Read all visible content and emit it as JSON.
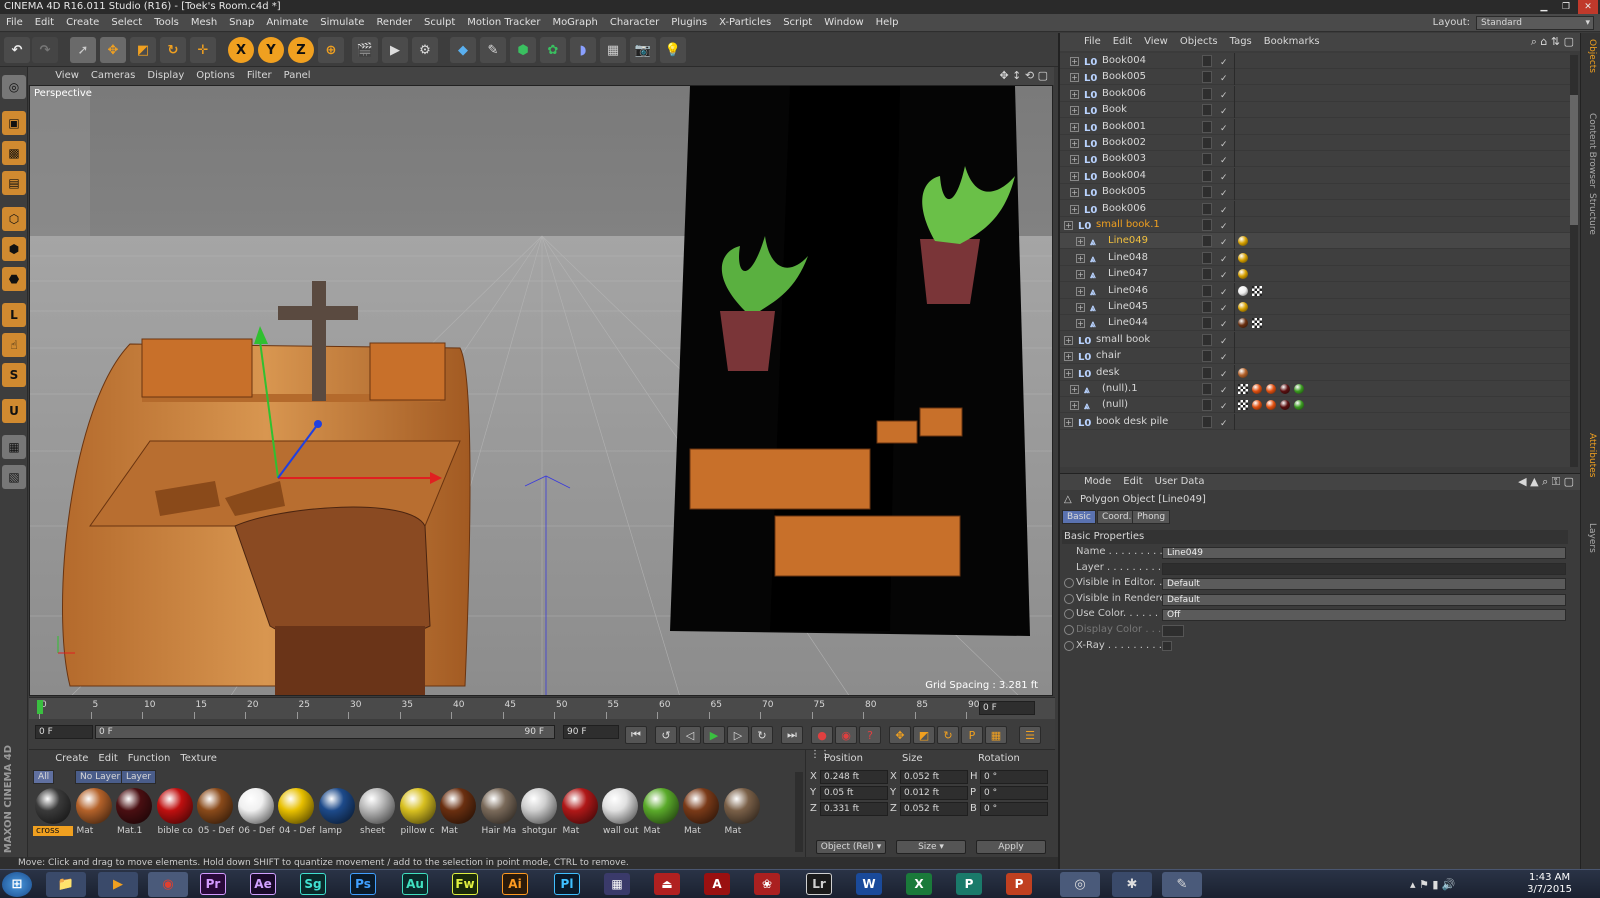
{
  "window": {
    "title": "CINEMA 4D R16.011 Studio (R16) - [Toek's Room.c4d *]"
  },
  "menubar": {
    "items": [
      "File",
      "Edit",
      "Create",
      "Select",
      "Tools",
      "Mesh",
      "Snap",
      "Animate",
      "Simulate",
      "Render",
      "Sculpt",
      "Motion Tracker",
      "MoGraph",
      "Character",
      "Plugins",
      "X-Particles",
      "Script",
      "Window",
      "Help"
    ],
    "layout_label": "Layout:",
    "layout_value": "Standard"
  },
  "toolbar": {
    "axis_x": "X",
    "axis_y": "Y",
    "axis_z": "Z"
  },
  "viewport": {
    "menu": [
      "View",
      "Cameras",
      "Display",
      "Options",
      "Filter",
      "Panel"
    ],
    "label": "Perspective",
    "grid_spacing": "Grid Spacing : 3.281 ft"
  },
  "timeline": {
    "ticks": [
      "0",
      "5",
      "10",
      "15",
      "20",
      "25",
      "30",
      "35",
      "40",
      "45",
      "50",
      "55",
      "60",
      "65",
      "70",
      "75",
      "80",
      "85",
      "90"
    ],
    "current": "0 F",
    "start": "0 F",
    "range_start": "0 F",
    "range_end": "90 F",
    "end": "90 F"
  },
  "material_manager": {
    "menu": [
      "Create",
      "Edit",
      "Function",
      "Texture"
    ],
    "tabs": [
      "All",
      "No Layer",
      "Layer"
    ],
    "materials": [
      {
        "name": "cross",
        "color": "#3a3a3a"
      },
      {
        "name": "Mat",
        "color": "#b4622a"
      },
      {
        "name": "Mat.1",
        "color": "#4a0f12"
      },
      {
        "name": "bible co",
        "color": "#c01010"
      },
      {
        "name": "05 - Def",
        "color": "#8a4a1a"
      },
      {
        "name": "06 - Def",
        "color": "#f0f0f0"
      },
      {
        "name": "04 - Def",
        "color": "#e8c000"
      },
      {
        "name": "lamp",
        "color": "#1d4a8a"
      },
      {
        "name": "sheet",
        "color": "#b8b8b8"
      },
      {
        "name": "pillow c",
        "color": "#d8c020"
      },
      {
        "name": "Mat",
        "color": "#6a2f10"
      },
      {
        "name": "Hair Ma",
        "color": "#7a6a5a"
      },
      {
        "name": "shotgur",
        "color": "#cfcfcf"
      },
      {
        "name": "Mat",
        "color": "#b01818"
      },
      {
        "name": "wall out",
        "color": "#e0e0e0"
      },
      {
        "name": "Mat",
        "color": "#5aaa2a"
      },
      {
        "name": "Mat",
        "color": "#7a3a18"
      },
      {
        "name": "Mat",
        "color": "#7a6048"
      }
    ]
  },
  "coordinates": {
    "headers": [
      "Position",
      "Size",
      "Rotation"
    ],
    "rows": [
      {
        "axis": "X",
        "pos": "0.248 ft",
        "size_axis": "X",
        "size": "0.052 ft",
        "rot_axis": "H",
        "rot": "0 °"
      },
      {
        "axis": "Y",
        "pos": "0.05 ft",
        "size_axis": "Y",
        "size": "0.012 ft",
        "rot_axis": "P",
        "rot": "0 °"
      },
      {
        "axis": "Z",
        "pos": "0.331 ft",
        "size_axis": "Z",
        "size": "0.052 ft",
        "rot_axis": "B",
        "rot": "0 °"
      }
    ],
    "mode": "Object (Rel)",
    "size_mode": "Size",
    "apply": "Apply"
  },
  "status": "Move: Click and drag to move elements. Hold down SHIFT to quantize movement / add to the selection in point mode, CTRL to remove.",
  "object_manager": {
    "menu": [
      "File",
      "Edit",
      "View",
      "Objects",
      "Tags",
      "Bookmarks"
    ],
    "objects": [
      {
        "name": "Book004",
        "indent": 1,
        "highlight": false,
        "tags": []
      },
      {
        "name": "Book005",
        "indent": 1,
        "highlight": false,
        "tags": []
      },
      {
        "name": "Book006",
        "indent": 1,
        "highlight": false,
        "tags": []
      },
      {
        "name": "Book",
        "indent": 1,
        "highlight": false,
        "tags": []
      },
      {
        "name": "Book001",
        "indent": 1,
        "highlight": false,
        "tags": []
      },
      {
        "name": "Book002",
        "indent": 1,
        "highlight": false,
        "tags": []
      },
      {
        "name": "Book003",
        "indent": 1,
        "highlight": false,
        "tags": []
      },
      {
        "name": "Book004",
        "indent": 1,
        "highlight": false,
        "tags": []
      },
      {
        "name": "Book005",
        "indent": 1,
        "highlight": false,
        "tags": []
      },
      {
        "name": "Book006",
        "indent": 1,
        "highlight": false,
        "tags": []
      },
      {
        "name": "small book.1",
        "indent": 0,
        "highlight": "orange",
        "tags": []
      },
      {
        "name": "Line049",
        "indent": 2,
        "highlight": "selected",
        "tags": [
          "#d6a000"
        ]
      },
      {
        "name": "Line048",
        "indent": 2,
        "highlight": false,
        "tags": [
          "#d6a000"
        ]
      },
      {
        "name": "Line047",
        "indent": 2,
        "highlight": false,
        "tags": [
          "#d6a000"
        ]
      },
      {
        "name": "Line046",
        "indent": 2,
        "highlight": false,
        "tags": [
          "#f0f0f0",
          "checker"
        ]
      },
      {
        "name": "Line045",
        "indent": 2,
        "highlight": false,
        "tags": [
          "#d6a000"
        ]
      },
      {
        "name": "Line044",
        "indent": 2,
        "highlight": false,
        "tags": [
          "#6a3010",
          "checker"
        ]
      },
      {
        "name": "small book",
        "indent": 0,
        "highlight": false,
        "tags": []
      },
      {
        "name": "chair",
        "indent": 0,
        "highlight": false,
        "tags": []
      },
      {
        "name": "desk",
        "indent": 0,
        "highlight": false,
        "tags": [
          "#b4622a"
        ]
      },
      {
        "name": "(null).1",
        "indent": 1,
        "highlight": false,
        "tags": [
          "checker",
          "#e05010",
          "#e05010",
          "#5a0f10",
          "#3a9a20"
        ]
      },
      {
        "name": "(null)",
        "indent": 1,
        "highlight": false,
        "tags": [
          "checker",
          "#e05010",
          "#e05010",
          "#5a0f10",
          "#3a9a20"
        ]
      },
      {
        "name": "book desk pile",
        "indent": 0,
        "highlight": false,
        "tags": []
      }
    ]
  },
  "attributes": {
    "menu": [
      "Mode",
      "Edit",
      "User Data"
    ],
    "object_title": "Polygon Object [Line049]",
    "tabs": [
      "Basic",
      "Coord.",
      "Phong"
    ],
    "section": "Basic Properties",
    "rows": [
      {
        "label": "Name . . . . . . . . . . .",
        "value": "Line049"
      },
      {
        "label": "Layer . . . . . . . . . . .",
        "value": ""
      },
      {
        "label": "Visible in Editor. .",
        "value": "Default"
      },
      {
        "label": "Visible in Renderer",
        "value": "Default"
      },
      {
        "label": "Use Color. . . . . . .",
        "value": "Off"
      },
      {
        "label": "Display Color . . .",
        "value": ""
      },
      {
        "label": "X-Ray . . . . . . . . . .",
        "value": ""
      }
    ]
  },
  "side_tabs": [
    "Objects",
    "Content Browser",
    "Structure",
    "Attributes",
    "Layers"
  ],
  "taskbar": {
    "apps": [
      "Pr",
      "Ae",
      "Sg",
      "Ps",
      "Au",
      "Fw",
      "Ai",
      "Pl",
      "Lr"
    ],
    "time": "1:43 AM",
    "date": "3/7/2015"
  },
  "branding": "MAXON CINEMA 4D"
}
